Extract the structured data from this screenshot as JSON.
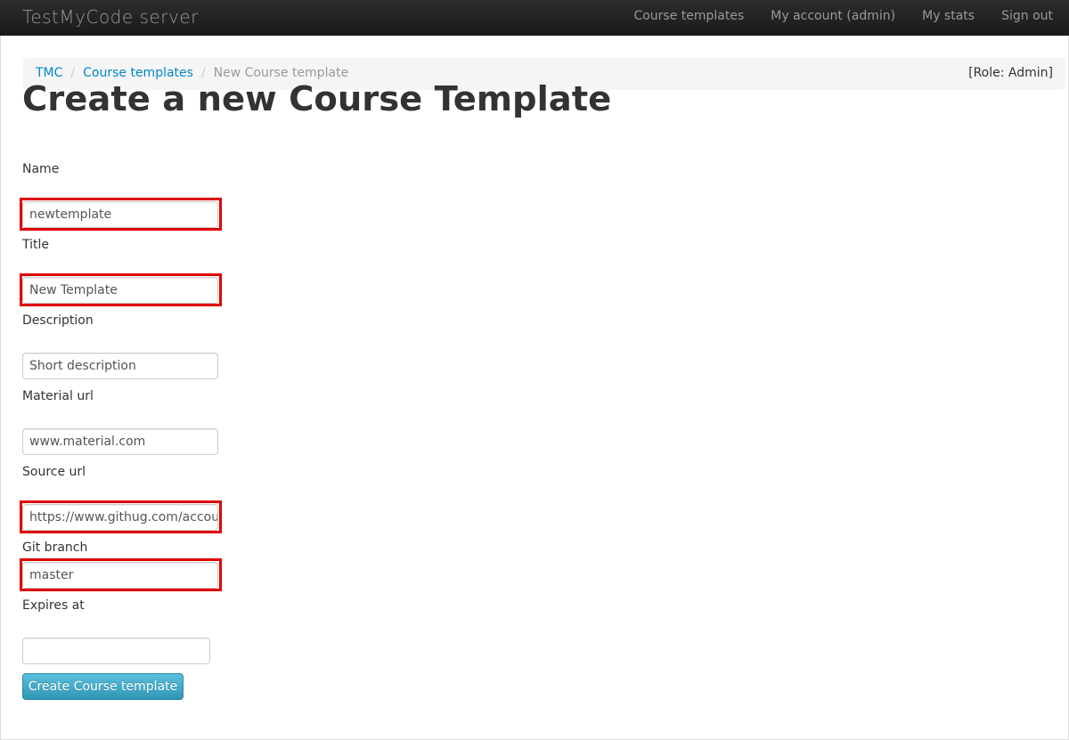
{
  "navbar": {
    "brand": "TestMyCode server",
    "links": [
      "Course templates",
      "My account (admin)",
      "My stats",
      "Sign out"
    ]
  },
  "breadcrumb": {
    "items": [
      "TMC",
      "Course templates"
    ],
    "active": "New Course template",
    "role": "[Role: Admin]"
  },
  "page_title": "Create a new Course Template",
  "form": {
    "name_label": "Name",
    "name_value": "newtemplate",
    "title_label": "Title",
    "title_value": "New Template",
    "description_label": "Description",
    "description_value": "Short description",
    "material_url_label": "Material url",
    "material_url_value": "www.material.com",
    "source_url_label": "Source url",
    "source_url_value": "https://www.githug.com/account",
    "git_branch_label": "Git branch",
    "git_branch_value": "master",
    "expires_at_label": "Expires at",
    "expires_at_value": "",
    "submit_label": "Create Course template"
  },
  "colors": {
    "navbar": "#1b1b1b",
    "link": "#0088cc",
    "highlight": "#e00000",
    "button": "#49afcd"
  }
}
